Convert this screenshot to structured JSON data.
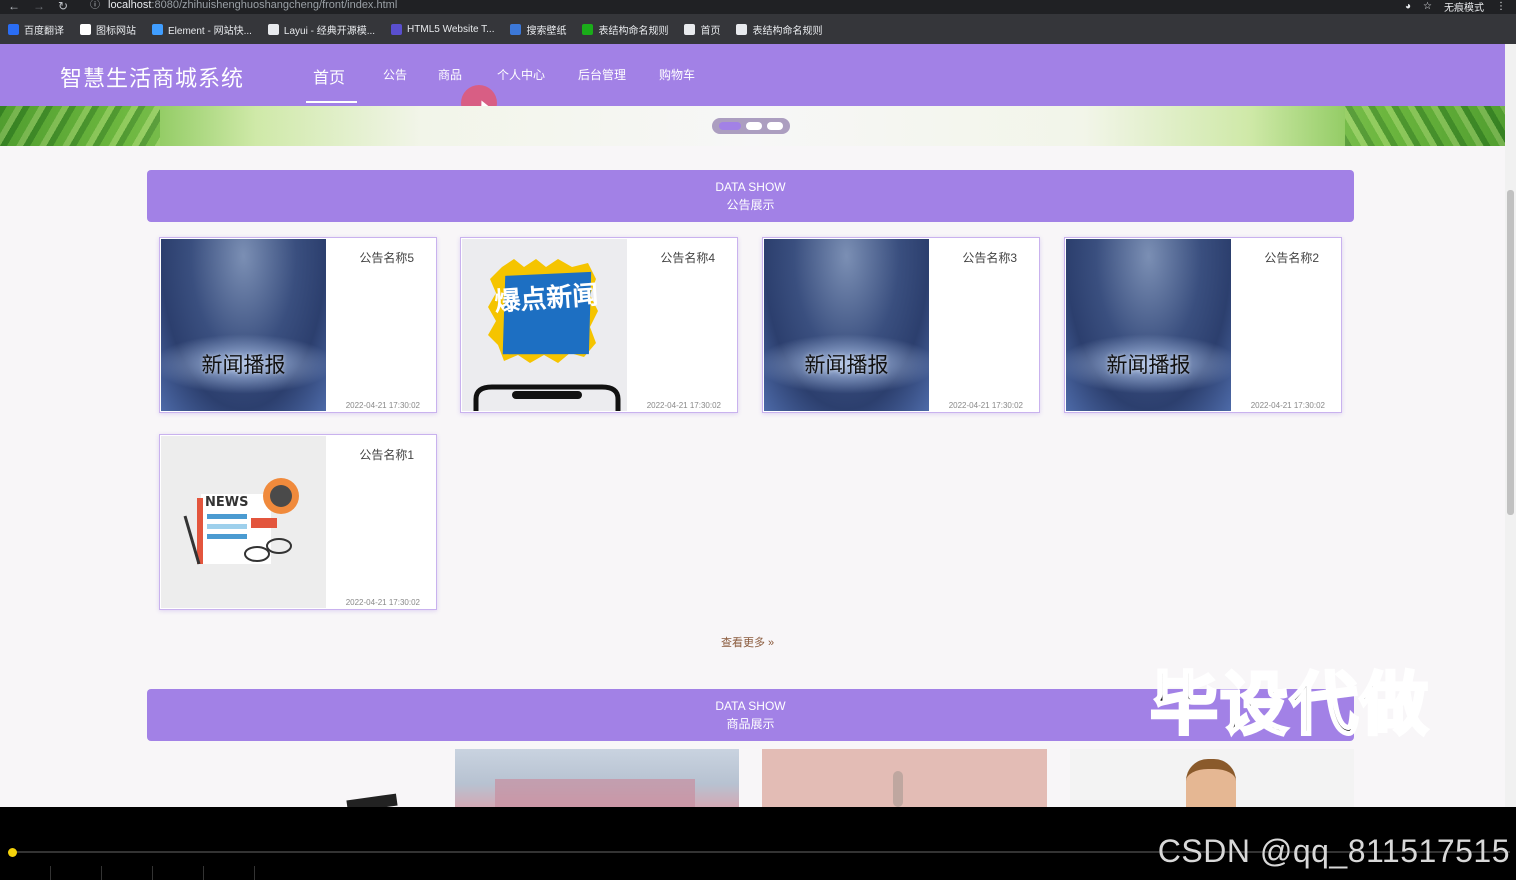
{
  "browser": {
    "url_host": "localhost",
    "url_rest": ":8080/zhihuishenghuoshangcheng/front/index.html",
    "incognito_label": "无痕模式",
    "bookmarks": [
      {
        "label": "百度翻译",
        "color": "#2a6df4"
      },
      {
        "label": "图标网站",
        "color": "#ffffff"
      },
      {
        "label": "Element - 网站快...",
        "color": "#409eff"
      },
      {
        "label": "Layui - 经典开源模...",
        "color": "#e8eaed"
      },
      {
        "label": "HTML5 Website T...",
        "color": "#5a4fcf"
      },
      {
        "label": "搜索壁纸",
        "color": "#3c78d8"
      },
      {
        "label": "表结构命名规则",
        "color": "#1aad19"
      },
      {
        "label": "首页",
        "color": "#e8eaed"
      },
      {
        "label": "表结构命名规则",
        "color": "#e8eaed"
      }
    ]
  },
  "site": {
    "title": "智慧生活商城系统",
    "nav": [
      "首页",
      "公告",
      "商品",
      "个人中心",
      "后台管理",
      "购物车"
    ],
    "active_nav": "首页",
    "accent_color": "#a281e6"
  },
  "notice_section": {
    "en": "DATA SHOW",
    "zh": "公告展示",
    "cards": [
      {
        "title": "公告名称5",
        "date": "2022-04-21 17:30:02",
        "image": "storm",
        "image_caption": "新闻播报"
      },
      {
        "title": "公告名称4",
        "date": "2022-04-21 17:30:02",
        "image": "boom",
        "image_caption": "爆点新闻"
      },
      {
        "title": "公告名称3",
        "date": "2022-04-21 17:30:02",
        "image": "storm",
        "image_caption": "新闻播报"
      },
      {
        "title": "公告名称2",
        "date": "2022-04-21 17:30:02",
        "image": "storm",
        "image_caption": "新闻播报"
      },
      {
        "title": "公告名称1",
        "date": "2022-04-21 17:30:02",
        "image": "news",
        "image_caption": "NEWS"
      }
    ],
    "more_label": "查看更多 »"
  },
  "product_section": {
    "en": "DATA SHOW",
    "zh": "商品展示"
  },
  "overlay": {
    "watermark": "毕设代做",
    "credit": "CSDN @qq_811517515"
  }
}
